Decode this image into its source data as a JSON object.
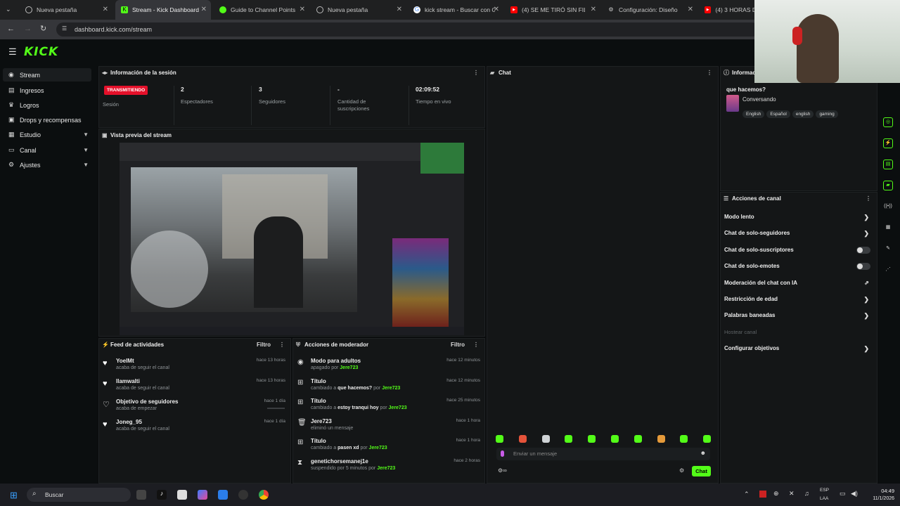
{
  "browser": {
    "tabs": [
      {
        "label": "Nueva pestaña",
        "icon": "globe-icon"
      },
      {
        "label": "Stream - Kick Dashboard",
        "icon": "kick-icon",
        "active": true
      },
      {
        "label": "Guide to Channel Points",
        "icon": "guide-icon"
      },
      {
        "label": "Nueva pestaña",
        "icon": "globe-icon"
      },
      {
        "label": "kick stream - Buscar con G",
        "icon": "google-icon"
      },
      {
        "label": "(4) SE ME TIRÓ SIN FILTR",
        "icon": "youtube-icon"
      },
      {
        "label": "Configuración: Diseño",
        "icon": "gear-icon"
      },
      {
        "label": "(4) 3 HORAS DE",
        "icon": "youtube-icon"
      }
    ],
    "url": "dashboard.kick.com/stream"
  },
  "app": {
    "logo": "KICK"
  },
  "sidebar": {
    "items": [
      {
        "label": "Stream",
        "icon": "video-icon"
      },
      {
        "label": "Ingresos",
        "icon": "money-icon"
      },
      {
        "label": "Logros",
        "icon": "trophy-icon"
      },
      {
        "label": "Drops y recompensas",
        "icon": "gift-icon"
      },
      {
        "label": "Estudio",
        "icon": "studio-icon"
      },
      {
        "label": "Canal",
        "icon": "channel-icon"
      },
      {
        "label": "Ajustes",
        "icon": "gear-icon"
      }
    ]
  },
  "session": {
    "title": "Información de la sesión",
    "status_badge": "TRANSMITIENDO",
    "status_label": "Sesión",
    "stats": [
      {
        "value": "2",
        "label": "Espectadores"
      },
      {
        "value": "3",
        "label": "Seguidores"
      },
      {
        "value": "-",
        "label": "Cantidad de suscripciones"
      },
      {
        "value": "02:09:52",
        "label": "Tiempo en vivo"
      }
    ]
  },
  "preview": {
    "title": "Vista previa del stream"
  },
  "chat": {
    "title": "Chat",
    "input_placeholder": "Enviar un mensaje",
    "send_label": "Chat",
    "accent": "#53fc18"
  },
  "info": {
    "title": "Informac",
    "stream_title": "que hacemos?",
    "category": "Conversando",
    "tags": [
      "English",
      "Español",
      "english",
      "gaming"
    ]
  },
  "channel_actions": {
    "title": "Acciones de canal",
    "items": [
      {
        "label": "Modo lento",
        "type": "chevron"
      },
      {
        "label": "Chat de solo-seguidores",
        "type": "chevron"
      },
      {
        "label": "Chat de solo-suscriptores",
        "type": "toggle"
      },
      {
        "label": "Chat de solo-emotes",
        "type": "toggle"
      },
      {
        "label": "Moderación del chat con IA",
        "type": "external"
      },
      {
        "label": "Restricción de edad",
        "type": "chevron"
      },
      {
        "label": "Palabras baneadas",
        "type": "chevron"
      },
      {
        "label": "Hostear canal",
        "type": "disabled"
      },
      {
        "label": "Configurar objetivos",
        "type": "chevron"
      }
    ]
  },
  "activity": {
    "title": "Feed de actividades",
    "filter_label": "Filtro",
    "items": [
      {
        "name": "YoelMt",
        "desc": "acaba de seguir el canal",
        "time": "hace 13 horas"
      },
      {
        "name": "llamwalti",
        "desc": "acaba de seguir el canal",
        "time": "hace 13 horas"
      },
      {
        "name": "Objetivo de seguidores",
        "desc": "acaba de empezar",
        "time": "hace 1 día"
      },
      {
        "name": "Joneg_95",
        "desc": "acaba de seguir el canal",
        "time": "hace 1 día"
      }
    ]
  },
  "mod_actions": {
    "title": "Acciones de moderador",
    "filter_label": "Filtro",
    "items": [
      {
        "name": "Modo para adultos",
        "pre": "apagado por",
        "bold": "",
        "mid": "",
        "user": "Jere723",
        "time": "hace 12 minutos"
      },
      {
        "name": "Título",
        "pre": "cambiado a",
        "bold": "que hacemos?",
        "mid": "por",
        "user": "Jere723",
        "time": "hace 12 minutos"
      },
      {
        "name": "Título",
        "pre": "cambiado a",
        "bold": "estoy tranqui hoy",
        "mid": "por",
        "user": "Jere723",
        "time": "hace 25 minutos"
      },
      {
        "name": "Jere723",
        "pre": "eliminó un mensaje",
        "bold": "",
        "mid": "",
        "user": "",
        "time": "hace 1 hora"
      },
      {
        "name": "Título",
        "pre": "cambiado a",
        "bold": "pasen xd",
        "mid": "por",
        "user": "Jere723",
        "time": "hace 1 hora"
      },
      {
        "name": "genetichorsemanej1e",
        "pre": "suspendido por 5 minutos por",
        "bold": "",
        "mid": "",
        "user": "Jere723",
        "time": "hace 2 horas"
      }
    ]
  },
  "taskbar": {
    "search_label": "Buscar",
    "lang": "ESP",
    "region": "LAA",
    "time": "04:49",
    "date": "11/1/2026"
  }
}
